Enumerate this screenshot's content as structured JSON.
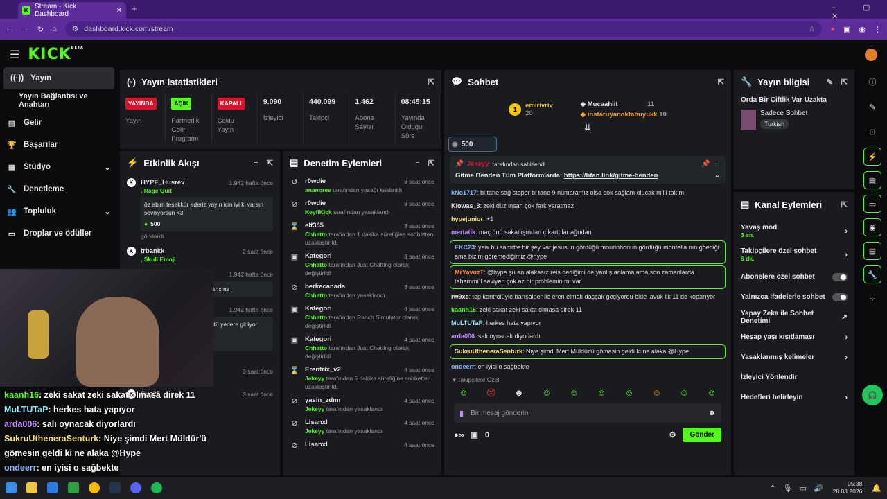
{
  "browser": {
    "tab_title": "Stream - Kick Dashboard",
    "url": "dashboard.kick.com/stream"
  },
  "kick": {
    "logo": "KICK",
    "beta": "BETA"
  },
  "nav": [
    {
      "label": "Yayın",
      "icon": "broadcast-icon"
    },
    {
      "label": "Yayın Bağlantısı ve Anahtarı"
    },
    {
      "label": "Gelir",
      "icon": "money-icon"
    },
    {
      "label": "Başarılar",
      "icon": "trophy-icon"
    },
    {
      "label": "Stüdyo",
      "icon": "studio-icon",
      "chev": "⌄"
    },
    {
      "label": "Denetleme",
      "icon": "wrench-icon"
    },
    {
      "label": "Topluluk",
      "icon": "people-icon",
      "chev": "⌄"
    },
    {
      "label": "Droplar ve ödüller",
      "icon": "drops-icon"
    }
  ],
  "stats": {
    "title": "Yayın İstatistikleri",
    "cells": [
      {
        "badge": "YAYINDA",
        "badge_color": "#e0112b",
        "label": "Yayın"
      },
      {
        "badge": "AÇIK",
        "badge_color": "#53fc18",
        "label": "Partnerlik Gelir Programı"
      },
      {
        "badge": "KAPALI",
        "badge_color": "#e0112b",
        "label": "Çoklu Yayın"
      },
      {
        "value": "9.090",
        "label": "İzleyici"
      },
      {
        "value": "440.099",
        "label": "Takipçi"
      },
      {
        "value": "1.462",
        "label": "Abone Sayısı"
      },
      {
        "value": "08:45:15",
        "label": "Yayında Olduğu Süre"
      }
    ]
  },
  "activity": {
    "title": "Etkinlik Akışı",
    "items": [
      {
        "name": "HYPE_Husrev",
        "time": "1.942 hafta önce",
        "detail": ", Rage Quit",
        "msg": "öz abim teşekkür ederiz yayın için iyi ki varsın seviliyorsun <3",
        "amount": "500",
        "note": "gönderdi"
      },
      {
        "name": "trbankk",
        "time": "2 saat önce",
        "detail": ", Skull Emoji"
      },
      {
        "name": "",
        "time": "1.942 hafta önce",
        "msg": "mi vurdun o nasil xmshxmshxms"
      },
      {
        "name": "",
        "time": "1.942 hafta önce",
        "msg": "arasına girdi Dünya çok kötü yerlere gidiyor 3.dünya savaşı yakında",
        "amount": "500",
        "note": "gönderdi"
      },
      {
        "name": "",
        "time": "3 saat önce",
        "note": "kanalı takip etti"
      },
      {
        "name": "Sue25",
        "time": "3 saat önce"
      }
    ]
  },
  "moderation": {
    "title": "Denetim Eylemleri",
    "items": [
      {
        "icon": "undo-icon",
        "user": "r0wdie",
        "time": "3 saat önce",
        "actor": "ananores",
        "text": "tarafından yasağı kaldırıldı"
      },
      {
        "icon": "ban-icon",
        "user": "r0wdie",
        "time": "3 saat önce",
        "actor": "KeyfiKick",
        "text": "tarafından yasaklandı"
      },
      {
        "icon": "hourglass-icon",
        "user": "elf355",
        "time": "3 saat önce",
        "actor": "Chhatto",
        "text": "tarafından 1 dakika süreliğine sohbetten uzaklaştırıldı"
      },
      {
        "icon": "category-icon",
        "user": "Kategori",
        "time": "3 saat önce",
        "actor": "Chhatto",
        "text": "tarafından Just Chatting olarak değiştirildi"
      },
      {
        "icon": "ban-icon",
        "user": "berkecanada",
        "time": "3 saat önce",
        "actor": "Chhatto",
        "text": "tarafından yasaklandı"
      },
      {
        "icon": "category-icon",
        "user": "Kategori",
        "time": "4 saat önce",
        "actor": "Chhatto",
        "text": "tarafından Ranch Simulator olarak değiştirildi"
      },
      {
        "icon": "category-icon",
        "user": "Kategori",
        "time": "4 saat önce",
        "actor": "Chhatto",
        "text": "tarafından Just Chatting olarak değiştirildi"
      },
      {
        "icon": "hourglass-icon",
        "user": "Erentrix_v2",
        "time": "4 saat önce",
        "actor": "Jekeyy",
        "text": "tarafından 5 dakika süreliğine sohbetten uzaklaştırıldı"
      },
      {
        "icon": "ban-icon",
        "user": "yasin_zdmr",
        "time": "4 saat önce",
        "actor": "Jekeyy",
        "text": "tarafından yasaklandı"
      },
      {
        "icon": "ban-icon",
        "user": "Lisanxl",
        "time": "4 saat önce",
        "actor": "Jekeyy",
        "text": "tarafından yasaklandı"
      },
      {
        "icon": "ban-icon",
        "user": "Lisanxl",
        "time": "4 saat önce"
      }
    ]
  },
  "chat": {
    "title": "Sohbet",
    "top_user": "emirivriv",
    "top_user_count": "20",
    "rank": "1",
    "tops": [
      {
        "name": "Mucaahiit",
        "count": "11"
      },
      {
        "name": "instaruyanoktabuyukk",
        "count": "10"
      }
    ],
    "gift_count": "500",
    "pinned_by": "Jekeyy",
    "pinned_label": "tarafından sabitlendi",
    "pinned_text": "Gitme Benden Tüm Platformlarda:",
    "pinned_link": "https://bfan.link/gitme-benden",
    "messages": [
      {
        "user": "kNo1717",
        "color": "#8ab4ff",
        "text": "bi tane sağ stoper bi tane 9 numaramız olsa cok sağlam olucak milli takım"
      },
      {
        "user": "Kiowas_3",
        "color": "#e6e6e6",
        "text": "zeki düz insan çok fark yaratmaz"
      },
      {
        "user": "hypejunior",
        "color": "#f5e26b",
        "text": "+1"
      },
      {
        "user": "mertatik",
        "color": "#c58cff",
        "text": "maç önü sakatlışından çıkarttılar ağrıdan"
      },
      {
        "user": "EKC23",
        "color": "#8ab4ff",
        "text": "yaw bu samrtte bir şey var jesusun gördüğü mourinhonun gördüğü montella nın göediği ama bizim göremediğimiz @hype",
        "hl": true
      },
      {
        "user": "MrYavuzT",
        "color": "#ff8c3a",
        "text": "@hype şu an alakasız reis dediğimi de yanlış anlama ama son zamanlarda tahammül seviyen çok az bir problemin mi var",
        "hl": true
      },
      {
        "user": "rw9xc",
        "color": "#e6e6e6",
        "text": "top kontrolüyle barışalper ile eren elmalı daşşak geçiyordu bide lavuk ilk 11 de koparıyor"
      },
      {
        "user": "kaanh16",
        "color": "#53fc18",
        "text": "zeki sakat zeki sakat olmasa direk 11"
      },
      {
        "user": "MuLTUTaP",
        "color": "#8ef",
        "text": "herkes hata yapıyor"
      },
      {
        "user": "arda006",
        "color": "#c58cff",
        "text": "salı oynacak diyorlardı"
      },
      {
        "user": "SukruUtheneraSenturk",
        "color": "#f5e26b",
        "text": "Niye şimdi Mert Müldür'ü gömesin geldi ki ne alaka @Hype",
        "hl": true
      },
      {
        "user": "ondeerr",
        "color": "#8ab4ff",
        "text": "en iyisi o sağbekte"
      }
    ],
    "followers_only": "Takipçilere Özel",
    "placeholder": "Bir mesaj gönderin",
    "send": "Gönder",
    "points": "0"
  },
  "info": {
    "title": "Yayın bilgisi",
    "stream_title": "Orda Bir Çiftlik Var Uzakta",
    "category": "Sadece Sohbet",
    "language": "Turkish"
  },
  "channel_actions": {
    "title": "Kanal Eylemleri",
    "items": [
      {
        "label": "Yavaş mod",
        "sub": "3 sn.",
        "ctrl": "›"
      },
      {
        "label": "Takipçilere özel sohbet",
        "sub": "6 dk.",
        "ctrl": "›"
      },
      {
        "label": "Abonelere özel sohbet",
        "ctrl": "toggle"
      },
      {
        "label": "Yalnızca ifadelerle sohbet",
        "ctrl": "toggle"
      },
      {
        "label": "Yapay Zeka ile Sohbet Denetimi",
        "ctrl": "↗"
      },
      {
        "label": "Hesap yaşı kısıtlaması",
        "ctrl": "›"
      },
      {
        "label": "Yasaklanmış kelimeler",
        "ctrl": "›"
      },
      {
        "label": "İzleyici Yönlendir"
      },
      {
        "label": "Hedefleri belirleyin",
        "ctrl": "›"
      }
    ]
  },
  "overlay_chat": [
    {
      "user": "kaanh16",
      "color": "#53fc18",
      "text": ": zeki sakat zeki sakat olmasa direk 11"
    },
    {
      "user": "MuLTUTaP",
      "color": "#8ef",
      "text": ": herkes hata yapıyor"
    },
    {
      "user": "arda006",
      "color": "#c58cff",
      "text": ": salı oynacak diyorlardı"
    },
    {
      "user": "SukruUtheneraSenturk",
      "color": "#f5e26b",
      "text": ": Niye şimdi Mert Müldür'ü gömesin geldi ki ne alaka @Hype"
    },
    {
      "user": "ondeerr",
      "color": "#8ab4ff",
      "text": ": en iyisi o sağbekte"
    }
  ],
  "clock": {
    "time": "05:38",
    "date": "28.03.2026"
  }
}
